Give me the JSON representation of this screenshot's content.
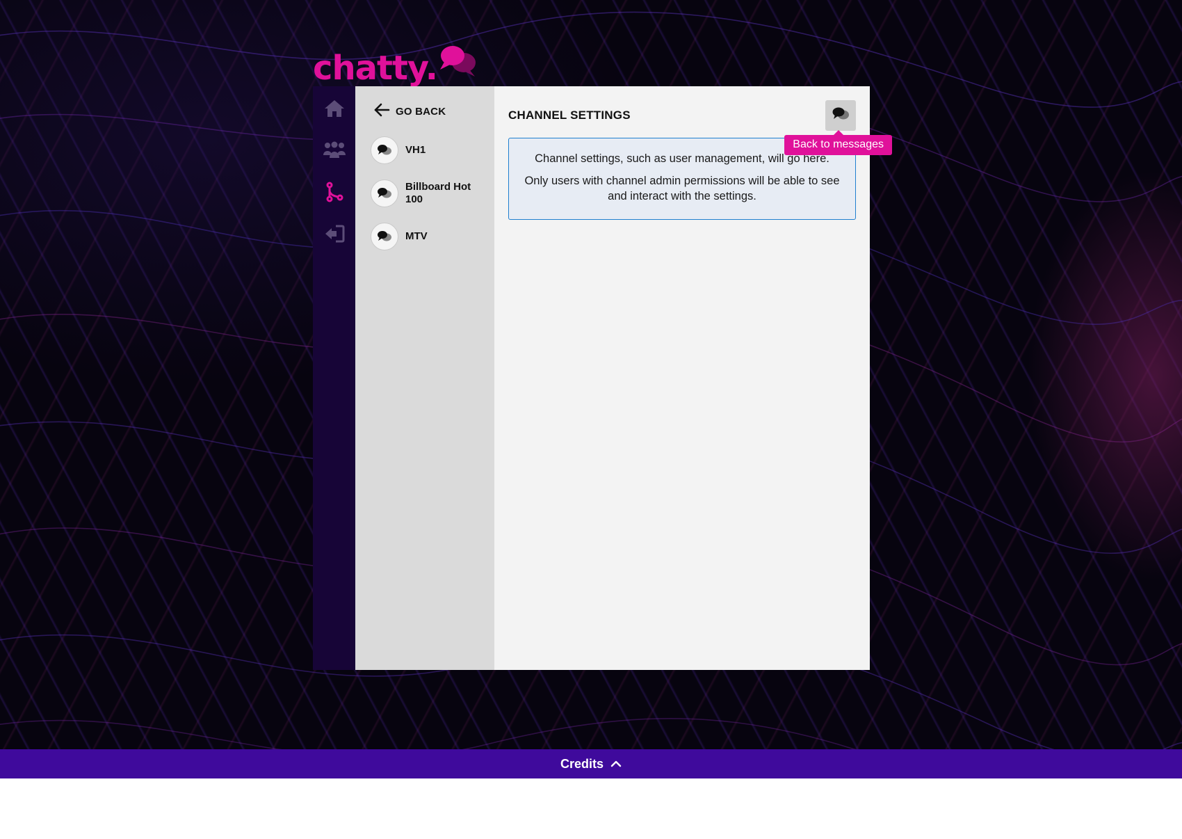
{
  "brand": {
    "logo_text": "chatty.",
    "accent_color": "#e0119a"
  },
  "nav": {
    "items": [
      {
        "icon": "home-icon",
        "active": false
      },
      {
        "icon": "users-icon",
        "active": false
      },
      {
        "icon": "branch-icon",
        "active": true
      },
      {
        "icon": "sign-out-icon",
        "active": false
      }
    ]
  },
  "channels": {
    "go_back_label": "GO BACK",
    "items": [
      {
        "name": "VH1"
      },
      {
        "name": "Billboard Hot 100"
      },
      {
        "name": "MTV"
      }
    ]
  },
  "main": {
    "title": "CHANNEL SETTINGS",
    "tooltip": "Back to messages",
    "info_line_1": "Channel settings, such as user management, will go here.",
    "info_line_2": "Only users with channel admin permissions will be able to see and interact with the settings."
  },
  "footer": {
    "credits_label": "Credits"
  },
  "colors": {
    "nav_bg": "#170537",
    "channel_bg": "#dadada",
    "main_bg": "#f3f3f3",
    "credits_bg": "#3f0a9c",
    "info_border": "#1f7fcf"
  }
}
